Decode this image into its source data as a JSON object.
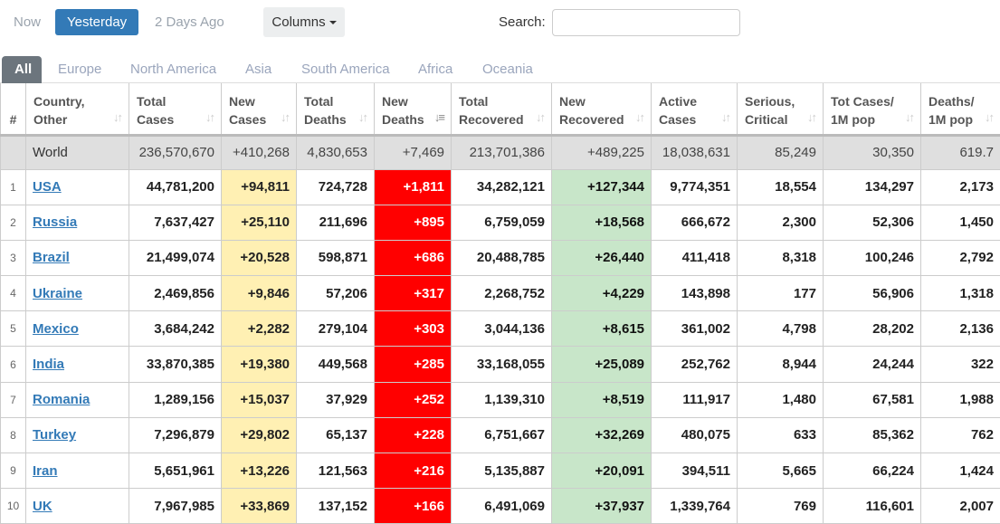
{
  "day_filter": {
    "options": [
      "Now",
      "Yesterday",
      "2 Days Ago"
    ],
    "selected": "Yesterday"
  },
  "columns_button": "Columns",
  "search": {
    "label": "Search:",
    "value": "",
    "placeholder": ""
  },
  "region_tabs": {
    "items": [
      "All",
      "Europe",
      "North America",
      "Asia",
      "South America",
      "Africa",
      "Oceania"
    ],
    "selected": "All"
  },
  "table": {
    "headers": [
      {
        "line1": "#",
        "line2": ""
      },
      {
        "line1": "Country,",
        "line2": "Other"
      },
      {
        "line1": "Total",
        "line2": "Cases"
      },
      {
        "line1": "New",
        "line2": "Cases"
      },
      {
        "line1": "Total",
        "line2": "Deaths"
      },
      {
        "line1": "New",
        "line2": "Deaths"
      },
      {
        "line1": "Total",
        "line2": "Recovered"
      },
      {
        "line1": "New",
        "line2": "Recovered"
      },
      {
        "line1": "Active",
        "line2": "Cases"
      },
      {
        "line1": "Serious,",
        "line2": "Critical"
      },
      {
        "line1": "Tot Cases/",
        "line2": "1M pop"
      },
      {
        "line1": "Deaths/",
        "line2": "1M pop"
      }
    ],
    "sorted_column": "New Deaths",
    "sort_icon": "sort-icon",
    "world": {
      "rank": "",
      "country": "World",
      "total_cases": "236,570,670",
      "new_cases": "+410,268",
      "total_deaths": "4,830,653",
      "new_deaths": "+7,469",
      "total_recovered": "213,701,386",
      "new_recovered": "+489,225",
      "active_cases": "18,038,631",
      "serious_critical": "85,249",
      "tot_cases_1m": "30,350",
      "deaths_1m": "619.7"
    },
    "rows": [
      {
        "rank": "1",
        "country": "USA",
        "total_cases": "44,781,200",
        "new_cases": "+94,811",
        "total_deaths": "724,728",
        "new_deaths": "+1,811",
        "total_recovered": "34,282,121",
        "new_recovered": "+127,344",
        "active_cases": "9,774,351",
        "serious_critical": "18,554",
        "tot_cases_1m": "134,297",
        "deaths_1m": "2,173"
      },
      {
        "rank": "2",
        "country": "Russia",
        "total_cases": "7,637,427",
        "new_cases": "+25,110",
        "total_deaths": "211,696",
        "new_deaths": "+895",
        "total_recovered": "6,759,059",
        "new_recovered": "+18,568",
        "active_cases": "666,672",
        "serious_critical": "2,300",
        "tot_cases_1m": "52,306",
        "deaths_1m": "1,450"
      },
      {
        "rank": "3",
        "country": "Brazil",
        "total_cases": "21,499,074",
        "new_cases": "+20,528",
        "total_deaths": "598,871",
        "new_deaths": "+686",
        "total_recovered": "20,488,785",
        "new_recovered": "+26,440",
        "active_cases": "411,418",
        "serious_critical": "8,318",
        "tot_cases_1m": "100,246",
        "deaths_1m": "2,792"
      },
      {
        "rank": "4",
        "country": "Ukraine",
        "total_cases": "2,469,856",
        "new_cases": "+9,846",
        "total_deaths": "57,206",
        "new_deaths": "+317",
        "total_recovered": "2,268,752",
        "new_recovered": "+4,229",
        "active_cases": "143,898",
        "serious_critical": "177",
        "tot_cases_1m": "56,906",
        "deaths_1m": "1,318"
      },
      {
        "rank": "5",
        "country": "Mexico",
        "total_cases": "3,684,242",
        "new_cases": "+2,282",
        "total_deaths": "279,104",
        "new_deaths": "+303",
        "total_recovered": "3,044,136",
        "new_recovered": "+8,615",
        "active_cases": "361,002",
        "serious_critical": "4,798",
        "tot_cases_1m": "28,202",
        "deaths_1m": "2,136"
      },
      {
        "rank": "6",
        "country": "India",
        "total_cases": "33,870,385",
        "new_cases": "+19,380",
        "total_deaths": "449,568",
        "new_deaths": "+285",
        "total_recovered": "33,168,055",
        "new_recovered": "+25,089",
        "active_cases": "252,762",
        "serious_critical": "8,944",
        "tot_cases_1m": "24,244",
        "deaths_1m": "322"
      },
      {
        "rank": "7",
        "country": "Romania",
        "total_cases": "1,289,156",
        "new_cases": "+15,037",
        "total_deaths": "37,929",
        "new_deaths": "+252",
        "total_recovered": "1,139,310",
        "new_recovered": "+8,519",
        "active_cases": "111,917",
        "serious_critical": "1,480",
        "tot_cases_1m": "67,581",
        "deaths_1m": "1,988"
      },
      {
        "rank": "8",
        "country": "Turkey",
        "total_cases": "7,296,879",
        "new_cases": "+29,802",
        "total_deaths": "65,137",
        "new_deaths": "+228",
        "total_recovered": "6,751,667",
        "new_recovered": "+32,269",
        "active_cases": "480,075",
        "serious_critical": "633",
        "tot_cases_1m": "85,362",
        "deaths_1m": "762"
      },
      {
        "rank": "9",
        "country": "Iran",
        "total_cases": "5,651,961",
        "new_cases": "+13,226",
        "total_deaths": "121,563",
        "new_deaths": "+216",
        "total_recovered": "5,135,887",
        "new_recovered": "+20,091",
        "active_cases": "394,511",
        "serious_critical": "5,665",
        "tot_cases_1m": "66,224",
        "deaths_1m": "1,424"
      },
      {
        "rank": "10",
        "country": "UK",
        "total_cases": "7,967,985",
        "new_cases": "+33,869",
        "total_deaths": "137,152",
        "new_deaths": "+166",
        "total_recovered": "6,491,069",
        "new_recovered": "+37,937",
        "active_cases": "1,339,764",
        "serious_critical": "769",
        "tot_cases_1m": "116,601",
        "deaths_1m": "2,007"
      }
    ]
  },
  "colors": {
    "accent": "#337ab7",
    "new_cases_bg": "#fff0b3",
    "new_deaths_bg": "#ff0000",
    "new_recovered_bg": "#c8e6c9",
    "world_row_bg": "#dfdfdf",
    "active_tab_bg": "#6c757d"
  }
}
